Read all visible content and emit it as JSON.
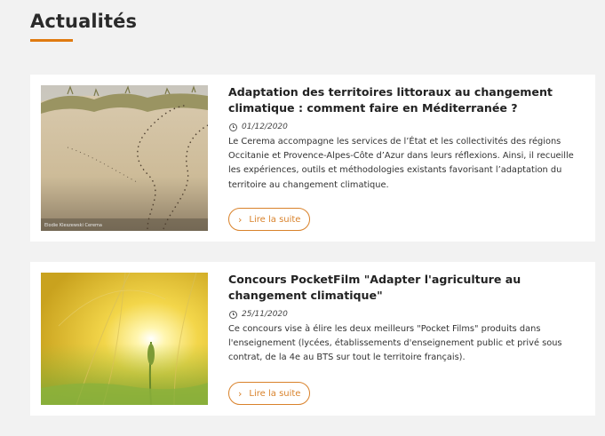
{
  "section": {
    "title": "Actualités"
  },
  "articles": [
    {
      "title": "Adaptation des territoires littoraux au changement climatique : comment faire en Méditerranée ?",
      "date": "01/12/2020",
      "excerpt": "Le Cerema accompagne les services de l’État et les collectivités des régions Occitanie et Provence-Alpes-Côte d’Azur dans leurs réflexions. Ainsi, il recueille les expériences, outils et méthodologies existants favorisant l’adaptation du territoire au changement climatique.",
      "read_more": "Lire la suite",
      "image_credit": "Elodie Kleszewski Cerema",
      "image": "sand-dunes-fence-photo"
    },
    {
      "title": "Concours PocketFilm \"Adapter l'agriculture au changement climatique\"",
      "date": "25/11/2020",
      "excerpt": "Ce concours vise à élire les deux meilleurs \"Pocket Films\" produits dans l'enseignement (lycées, établissements d'enseignement public et privé sous contrat, de la 4e au BTS sur tout le territoire français).",
      "read_more": "Lire la suite",
      "image": "wheat-field-sunset-photo"
    }
  ],
  "colors": {
    "accent": "#e07a10",
    "button": "#d9822b",
    "background": "#f2f2f2"
  },
  "icons": {
    "date": "clock-icon",
    "read_more": "chevron-right-icon"
  }
}
